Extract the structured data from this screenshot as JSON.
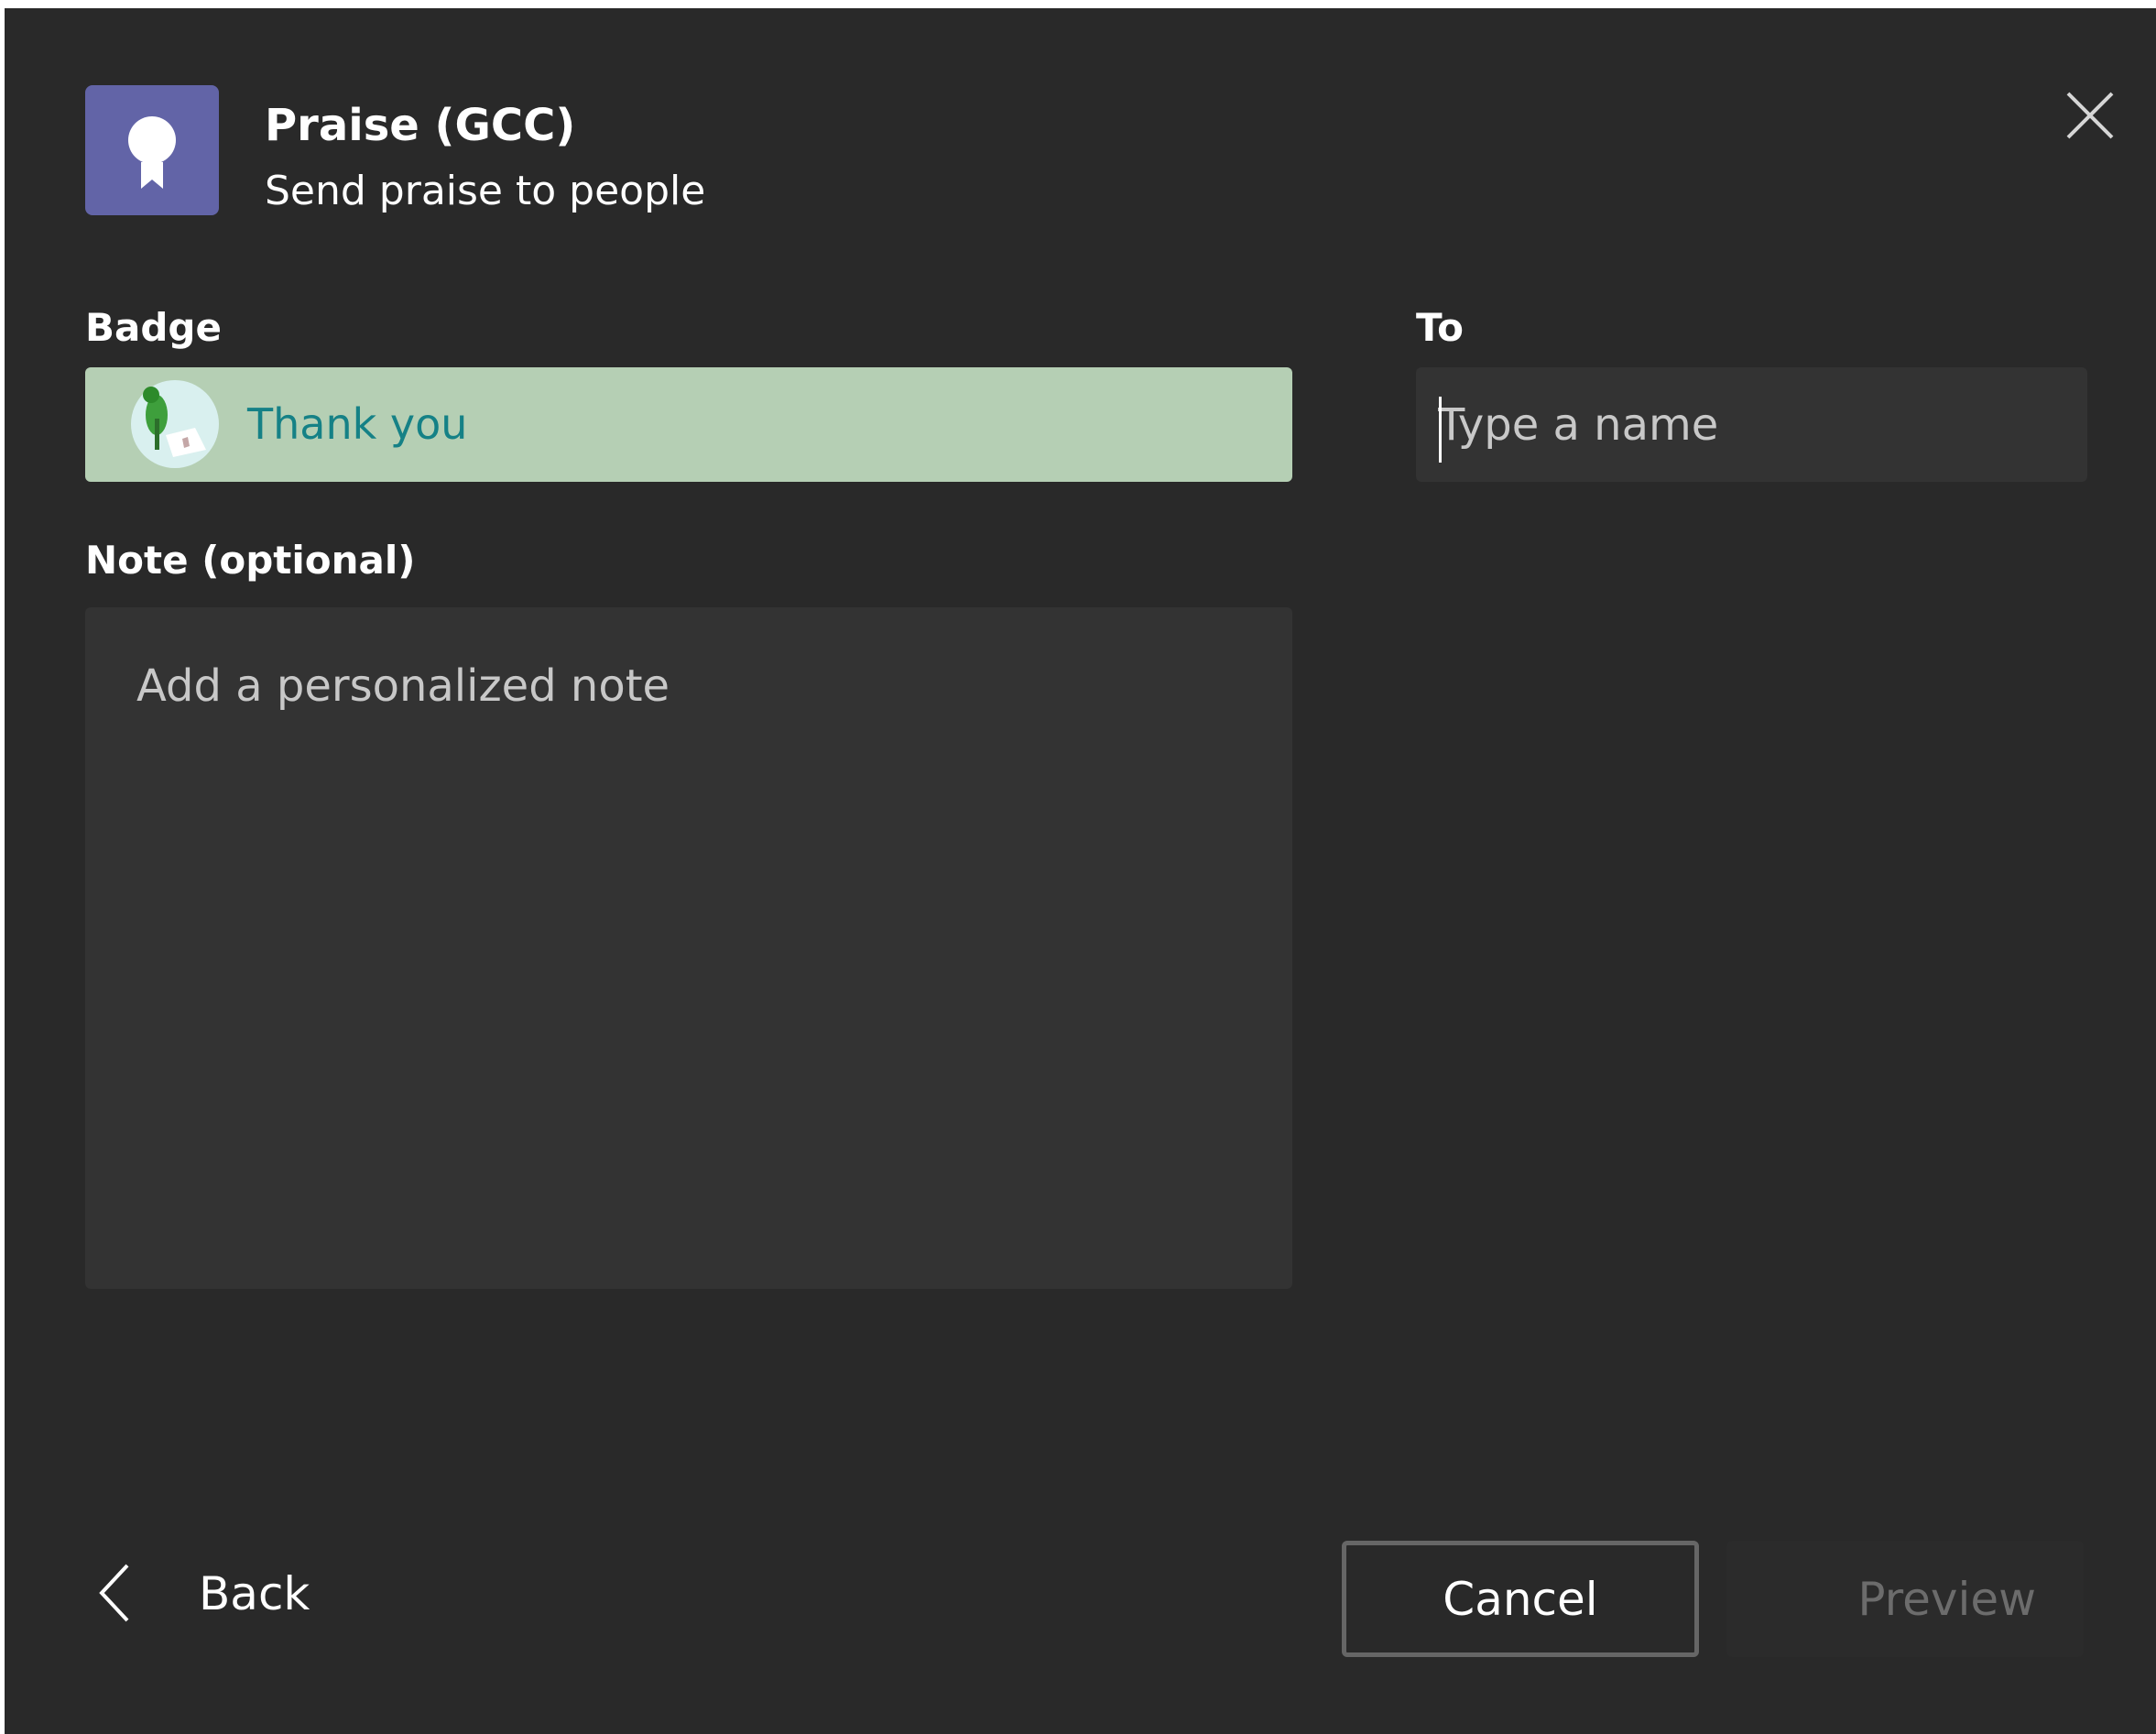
{
  "header": {
    "app_icon": "ribbon-badge-icon",
    "title": "Praise (GCC)",
    "subtitle": "Send praise to people",
    "close_icon": "close-icon"
  },
  "badge": {
    "label": "Badge",
    "selected": "Thank you",
    "icon": "thank-you-badge-icon",
    "background_color": "#b5cfb4",
    "text_color": "#158186"
  },
  "to": {
    "label": "To",
    "placeholder": "Type a name",
    "value": ""
  },
  "note": {
    "label": "Note (optional)",
    "placeholder": "Add a personalized note",
    "value": ""
  },
  "footer": {
    "back_label": "Back",
    "back_icon": "chevron-left-icon",
    "cancel_label": "Cancel",
    "preview_label": "Preview"
  },
  "colors": {
    "dialog_background": "#292929",
    "input_background": "#333333",
    "accent": "#6264a7"
  }
}
